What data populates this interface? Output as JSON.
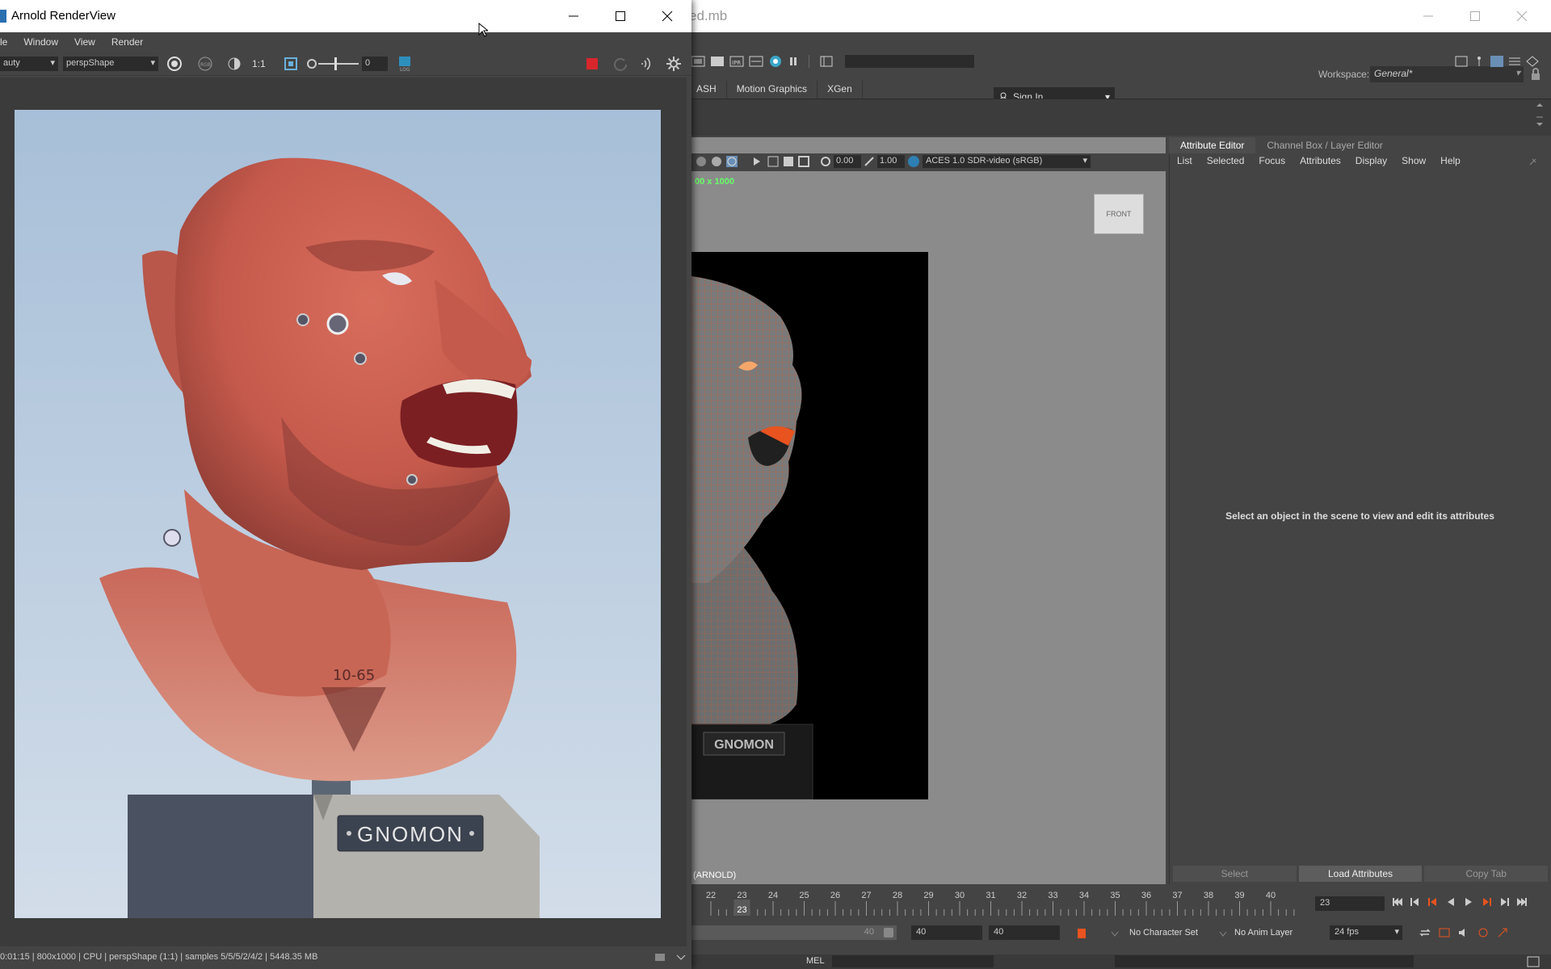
{
  "maya": {
    "title_fragment": "ed.mb",
    "workspace_label": "Workspace:",
    "workspace_value": "General*",
    "sign_in": "Sign In",
    "shelf_tabs": [
      "ASH",
      "Motion Graphics",
      "XGen"
    ],
    "viewport": {
      "exposure": "0.00",
      "gamma": "1.00",
      "color_space": "ACES 1.0 SDR-video (sRGB)",
      "resolution_fragment": "00 x 1000",
      "camera_label": "(ARNOLD)",
      "viewcube_label": "FRONT",
      "plate_text": "GNOMON"
    },
    "attribute_editor": {
      "tabs": [
        "Attribute Editor",
        "Channel Box / Layer Editor"
      ],
      "menu": [
        "List",
        "Selected",
        "Focus",
        "Attributes",
        "Display",
        "Show",
        "Help"
      ],
      "message": "Select an object in the scene to view and edit its attributes",
      "buttons": [
        "Select",
        "Load Attributes",
        "Copy Tab"
      ]
    },
    "timeline": {
      "ticks": [
        "22",
        "23",
        "24",
        "25",
        "26",
        "27",
        "28",
        "29",
        "30",
        "31",
        "32",
        "33",
        "34",
        "35",
        "36",
        "37",
        "38",
        "39",
        "40"
      ],
      "current_frame_label": "23",
      "current_frame_field": "23"
    },
    "range": {
      "range_end": "40",
      "anim_end": "40",
      "playback_end": "40",
      "character_set": "No Character Set",
      "anim_layer": "No Anim Layer",
      "fps": "24 fps"
    },
    "cmd_lang": "MEL"
  },
  "arv": {
    "title": "Arnold RenderView",
    "menu": [
      "le",
      "Window",
      "View",
      "Render"
    ],
    "aov": "auty",
    "camera": "perspShape",
    "ratio": "1:1",
    "exposure": "0",
    "plate_text": "GNOMON",
    "neck_tattoo": "10-65",
    "status": "0:01:15 | 800x1000 | CPU | perspShape (1:1) | samples 5/5/5/2/4/2 | 5448.35 MB"
  },
  "colors": {
    "maya_bg": "#444444",
    "stop_button": "#d9262c",
    "sky_top": "#a7bfd8",
    "sky_bottom": "#d2dde9",
    "skin": "#c55a4c",
    "wire": "#e8531f"
  }
}
